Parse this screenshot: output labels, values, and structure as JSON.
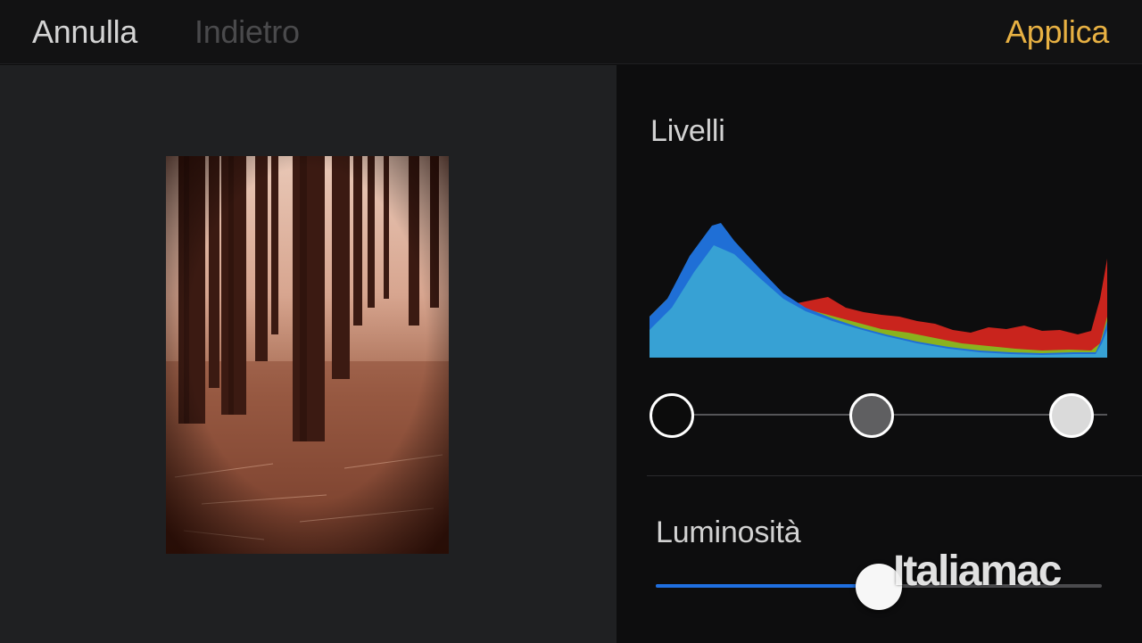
{
  "toolbar": {
    "cancel_label": "Annulla",
    "back_label": "Indietro",
    "apply_label": "Applica",
    "accent_color": "#e8b143"
  },
  "panel": {
    "levels_title": "Livelli",
    "brightness_title": "Luminosità",
    "levels": {
      "black_point": 0.0,
      "midtone": 0.5,
      "white_point": 1.0
    },
    "brightness_value": 0.5
  },
  "histogram_colors": {
    "blue": "#1f6fd6",
    "cyan": "#3aa6d4",
    "green": "#8ab21e",
    "red": "#c9241d"
  },
  "watermark": "Italiamac"
}
